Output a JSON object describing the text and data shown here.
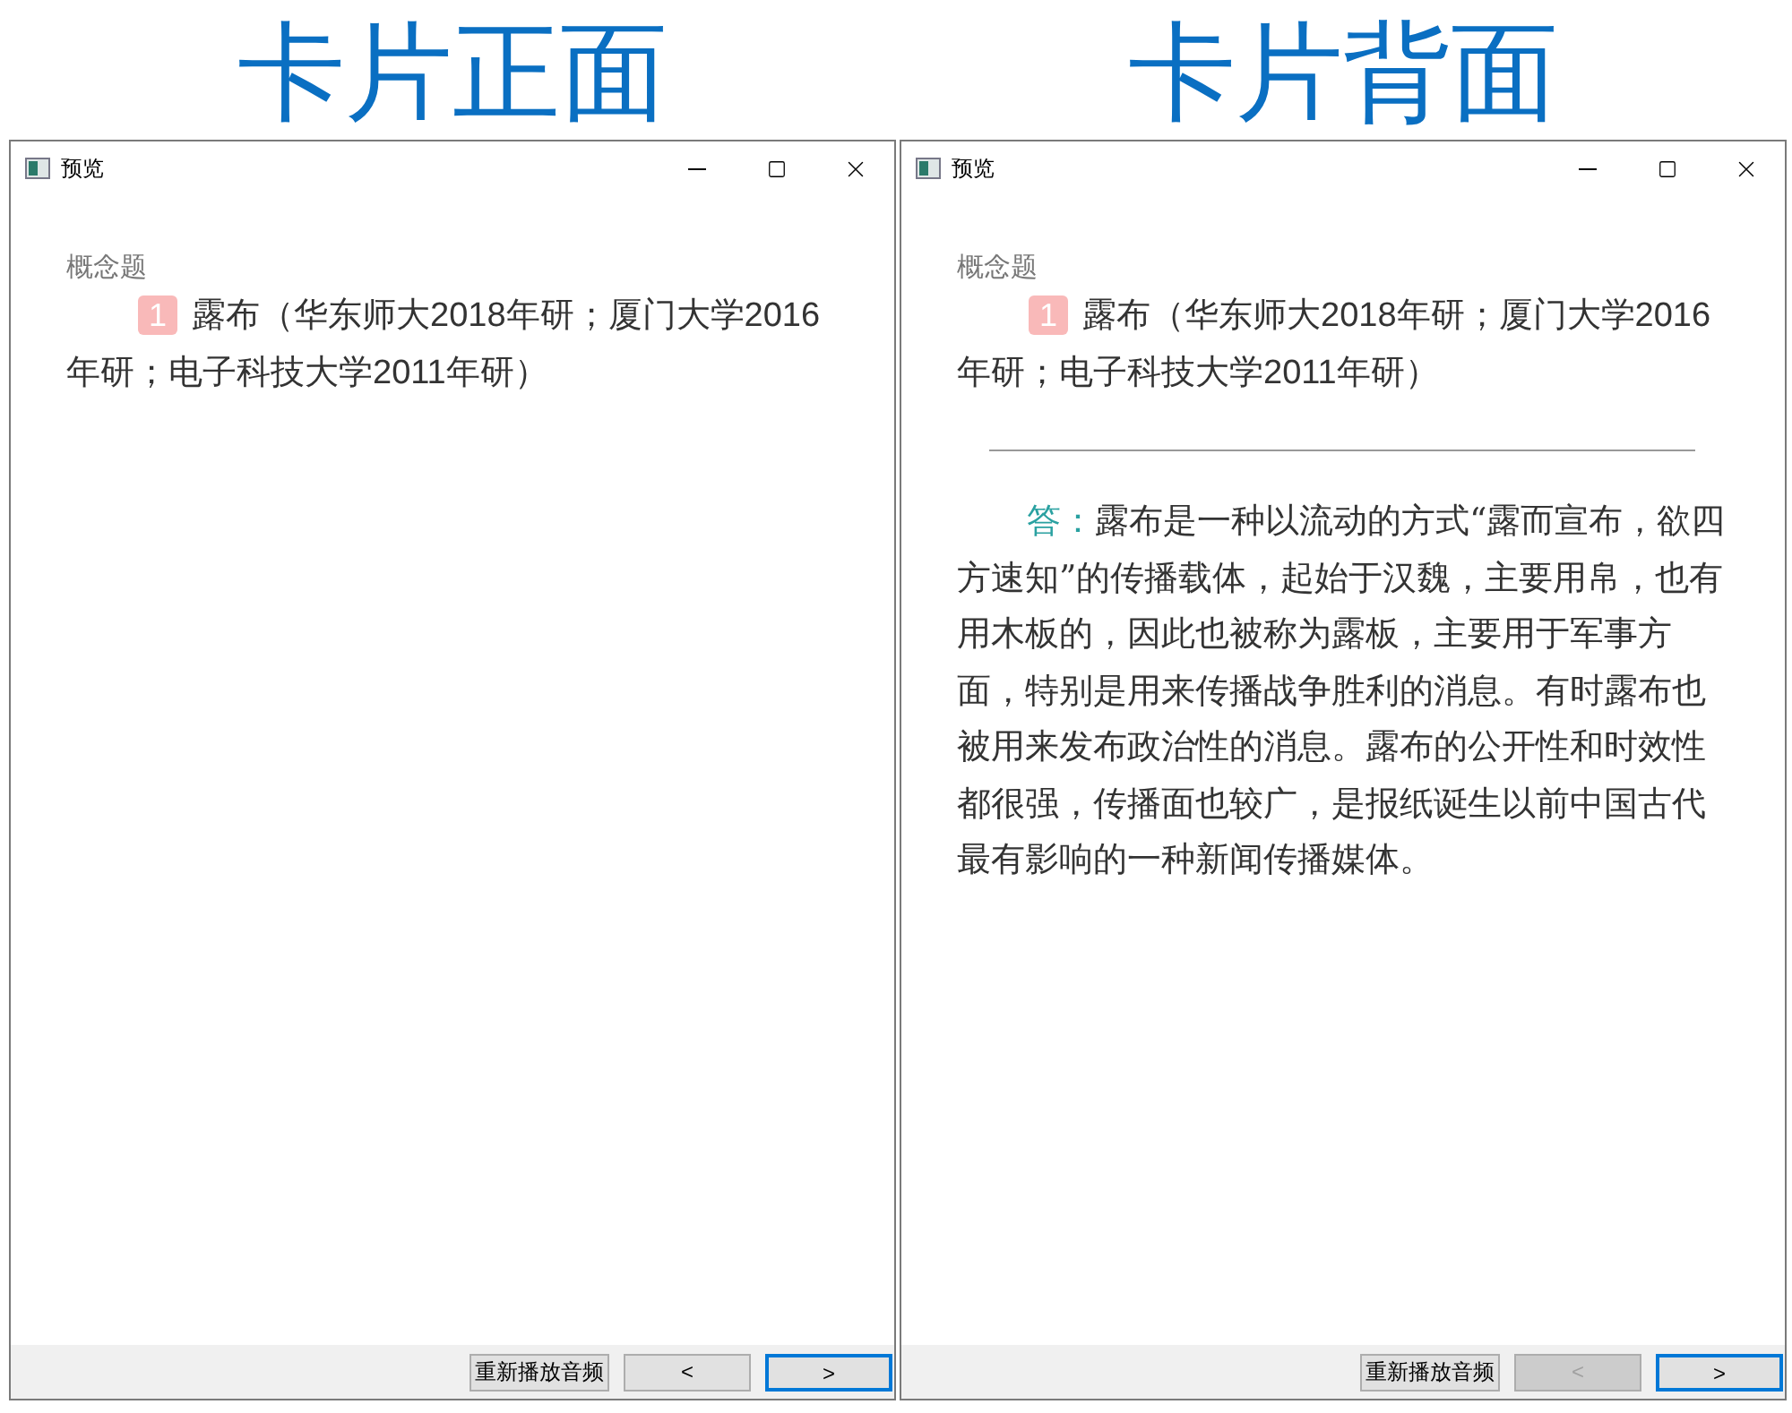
{
  "panels": [
    {
      "heading": "卡片正面",
      "window": {
        "title": "预览"
      },
      "category": "概念题",
      "question": {
        "number": "1",
        "text": "露布（华东师大2018年研；厦门大学2016年研；电子科技大学2011年研）"
      },
      "buttons": [
        {
          "label": "重新播放音频",
          "disabled": false,
          "focused": false
        },
        {
          "label": "<",
          "disabled": false,
          "focused": false
        },
        {
          "label": ">",
          "disabled": false,
          "focused": true
        }
      ]
    },
    {
      "heading": "卡片背面",
      "window": {
        "title": "预览"
      },
      "category": "概念题",
      "question": {
        "number": "1",
        "text": "露布（华东师大2018年研；厦门大学2016年研；电子科技大学2011年研）"
      },
      "answer": {
        "label": "答：",
        "text": "露布是一种以流动的方式“露而宣布，欲四方速知”的传播载体，起始于汉魏，主要用帛，也有用木板的，因此也被称为露板，主要用于军事方面，特别是用来传播战争胜利的消息。有时露布也被用来发布政治性的消息。露布的公开性和时效性都很强，传播面也较广，是报纸诞生以前中国古代最有影响的一种新闻传播媒体。"
      },
      "buttons": [
        {
          "label": "重新播放音频",
          "disabled": false,
          "focused": false
        },
        {
          "label": "<",
          "disabled": true,
          "focused": false
        },
        {
          "label": ">",
          "disabled": false,
          "focused": true
        }
      ]
    }
  ]
}
